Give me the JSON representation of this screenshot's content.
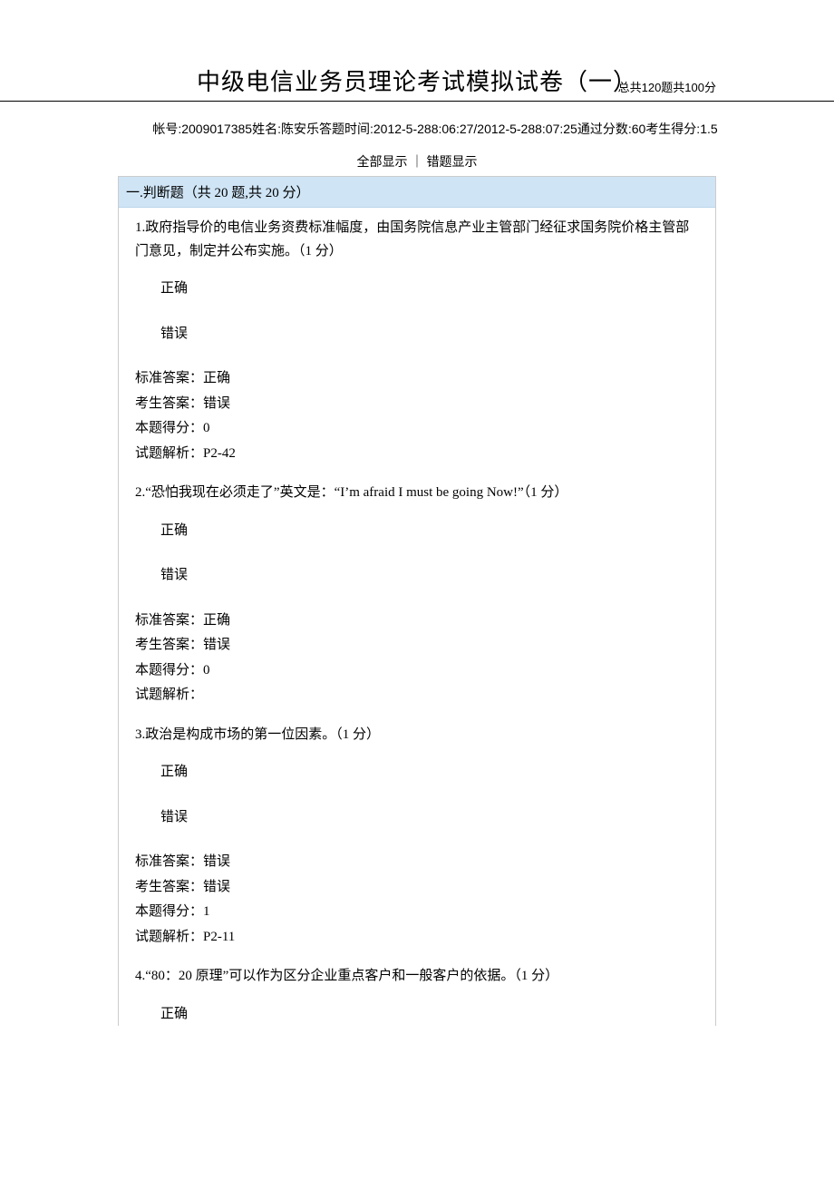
{
  "header": {
    "title": "中级电信业务员理论考试模拟试卷（一）",
    "summary": "总共120题共100分"
  },
  "sub": {
    "account_label": "帐号:",
    "account": "2009017385",
    "name_label": "姓名:",
    "name": "陈安乐",
    "time_label": "答题时间:",
    "time": "2012-5-288:06:27/2012-5-288:07:25",
    "pass_label": "通过分数:",
    "pass": "60",
    "score_label": "考生得分:",
    "score": "1.5"
  },
  "toggle": {
    "all": "全部显示",
    "sep": "｜",
    "wrong": "错题显示"
  },
  "section1": {
    "title": "一.判断题（共 20 题,共 20 分）"
  },
  "labels": {
    "opt_true": "正确",
    "opt_false": "错误",
    "std_answer": "标准答案：",
    "user_answer": "考生答案：",
    "score": "本题得分：",
    "explain": "试题解析："
  },
  "q1": {
    "text": "1.政府指导价的电信业务资费标准幅度，由国务院信息产业主管部门经征求国务院价格主管部门意见，制定并公布实施。（1 分）",
    "std": "正确",
    "user": "错误",
    "score": "0",
    "explain": "P2-42"
  },
  "q2": {
    "text": "2.“恐怕我现在必须走了”英文是：“I’m afraid I must be going Now!”（1 分）",
    "std": "正确",
    "user": "错误",
    "score": "0",
    "explain": ""
  },
  "q3": {
    "text": "3.政治是构成市场的第一位因素。（1 分）",
    "std": "错误",
    "user": "错误",
    "score": "1",
    "explain": "P2-11"
  },
  "q4": {
    "text": "4.“80：20 原理”可以作为区分企业重点客户和一般客户的依据。（1 分）"
  }
}
